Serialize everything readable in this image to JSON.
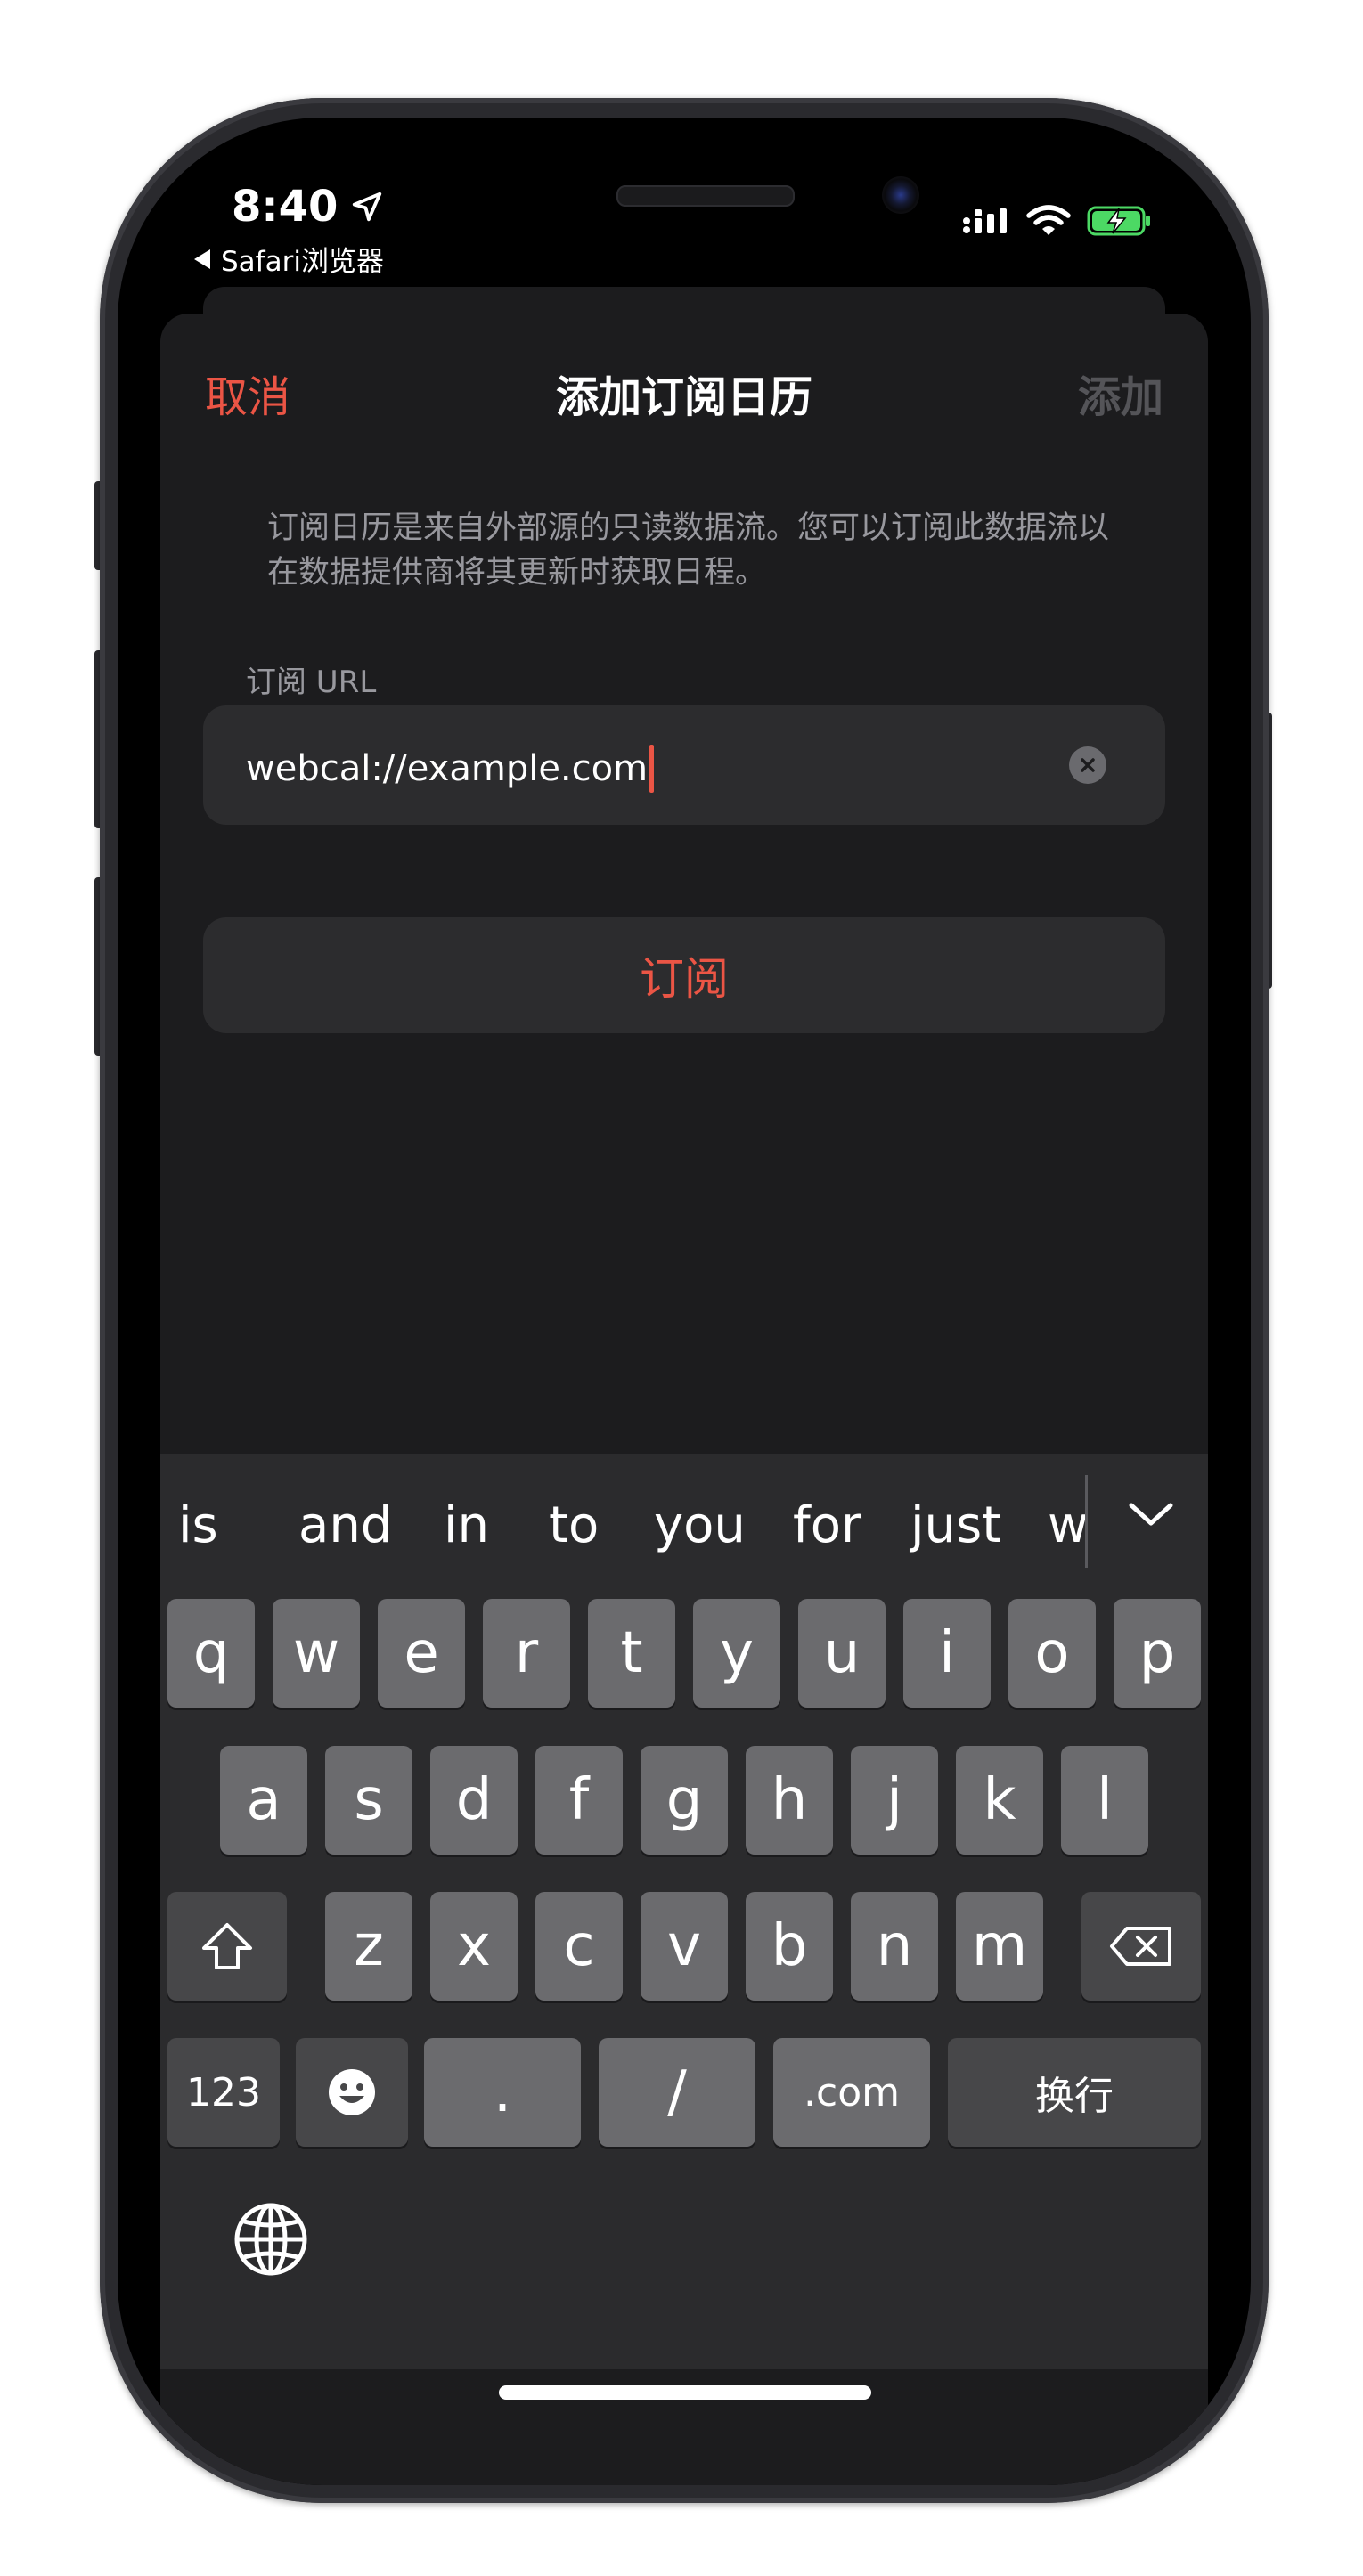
{
  "status": {
    "time": "8:40",
    "back_app": "Safari浏览器"
  },
  "nav": {
    "cancel": "取消",
    "title": "添加订阅日历",
    "add": "添加"
  },
  "description": "订阅日历是来自外部源的只读数据流。您可以订阅此数据流以在数据提供商将其更新时获取日程。",
  "url_field": {
    "label": "订阅 URL",
    "value": "webcal://example.com"
  },
  "subscribe_button": "订阅",
  "keyboard": {
    "suggestions": [
      "is",
      "and",
      "in",
      "to",
      "you",
      "for",
      "just",
      "w"
    ],
    "row1": [
      "q",
      "w",
      "e",
      "r",
      "t",
      "y",
      "u",
      "i",
      "o",
      "p"
    ],
    "row2": [
      "a",
      "s",
      "d",
      "f",
      "g",
      "h",
      "j",
      "k",
      "l"
    ],
    "row3": [
      "z",
      "x",
      "c",
      "v",
      "b",
      "n",
      "m"
    ],
    "bottom": {
      "numbers": "123",
      "dot": ".",
      "slash": "/",
      "dotcom": ".com",
      "return": "换行"
    }
  },
  "colors": {
    "accent": "#eb5545",
    "sheet_bg": "#1c1c1e",
    "field_bg": "#2c2c2e",
    "key_bg": "#6b6b6e",
    "key_dark_bg": "#474749"
  }
}
